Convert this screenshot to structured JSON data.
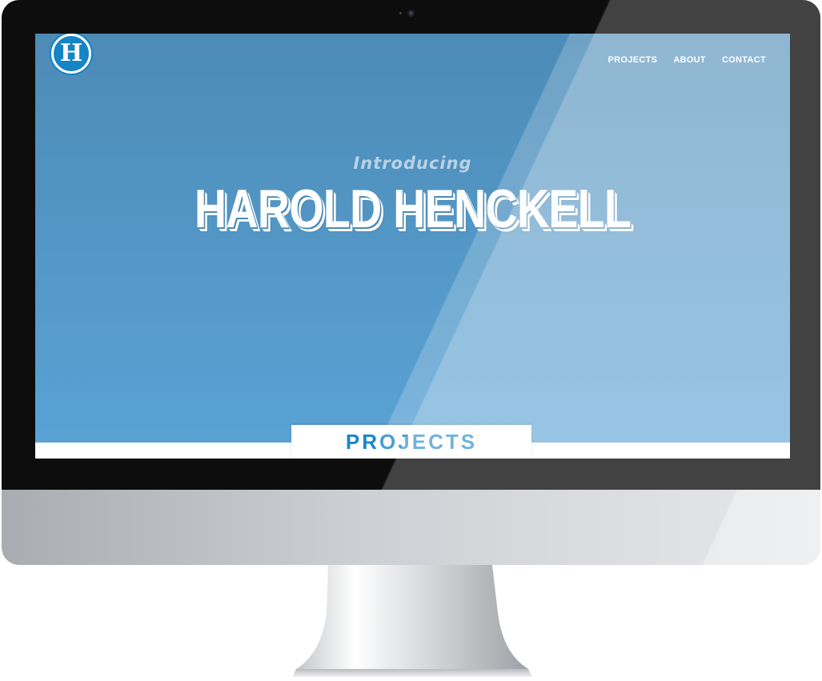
{
  "site": {
    "logo_letter": "H",
    "nav": {
      "projects": "PROJECTS",
      "about": "ABOUT",
      "contact": "CONTACT"
    },
    "hero": {
      "intro": "Introducing",
      "name": "HAROLD HENCKELL"
    },
    "section_tab": "PROJECTS"
  },
  "colors": {
    "brand_blue": "#1784c5",
    "hero_top": "#4c8bb6",
    "hero_bottom": "#5aa3d6",
    "tab_text": "#1a87c8"
  },
  "icons": {
    "logo": "h-monogram-badge",
    "camera": "webcam-dot"
  }
}
